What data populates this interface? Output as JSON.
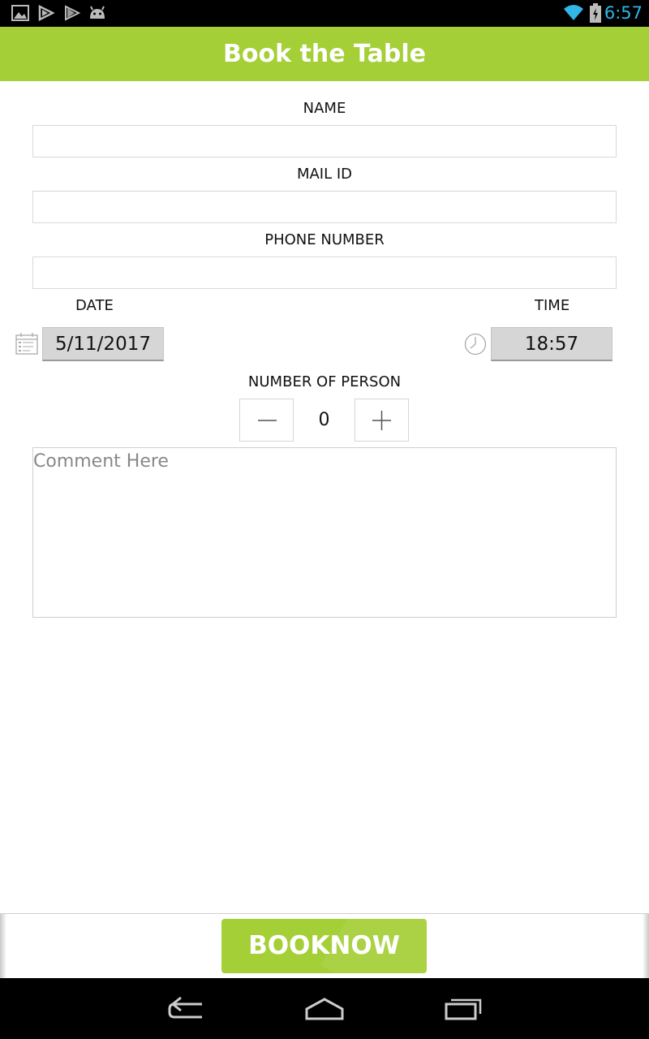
{
  "status_bar": {
    "time": "6:57",
    "left_icons": [
      "image-icon",
      "play-store-icon",
      "play-store-icon",
      "android-icon"
    ],
    "right_icons": [
      "wifi-icon",
      "battery-charging-icon"
    ]
  },
  "header": {
    "title": "Book the Table"
  },
  "form": {
    "name_label": "NAME",
    "name_value": "",
    "mail_label": "MAIL ID",
    "mail_value": "",
    "phone_label": "PHONE NUMBER",
    "phone_value": "",
    "date_label": "DATE",
    "date_value": "5/11/2017",
    "time_label": "TIME",
    "time_value": "18:57",
    "persons_label": "NUMBER OF PERSON",
    "persons_value": "0",
    "comment_placeholder": "Comment Here",
    "comment_value": ""
  },
  "footer": {
    "book_button_label": "BOOKNOW"
  },
  "nav_bar": {
    "icons": [
      "back-icon",
      "home-icon",
      "recent-apps-icon"
    ]
  },
  "colors": {
    "accent": "#a4cf36",
    "status_time": "#33b5e5"
  }
}
